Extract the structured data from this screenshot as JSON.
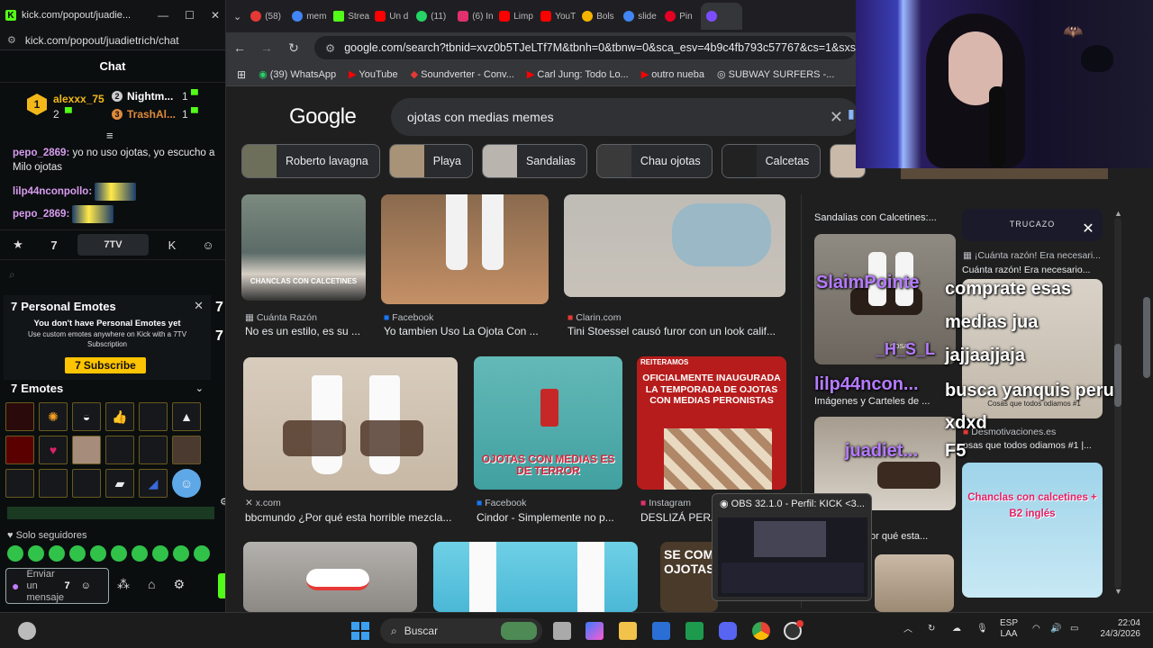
{
  "kick": {
    "window_title": "kick.com/popout/juadie...",
    "url": "kick.com/popout/juadietrich/chat",
    "chat_title": "Chat",
    "leaderboard": [
      {
        "rank": "1",
        "name": "alexxx_75",
        "count": "2"
      },
      {
        "rank": "2",
        "name": "Nightm...",
        "count": "1"
      },
      {
        "rank": "3",
        "name": "TrashAl...",
        "count": "1"
      }
    ],
    "messages": [
      {
        "user": "pepo_2869:",
        "text": " yo no uso ojotas, yo escucho a Milo ojotas",
        "color": "#d89cf0"
      },
      {
        "user": "lilp44nconpollo:",
        "text": "",
        "color": "#d89cf0"
      },
      {
        "user": "pepo_2869:",
        "text": "",
        "color": "#d89cf0"
      }
    ],
    "tab_active": "7TV",
    "personal_emotes": {
      "title": "Personal Emotes",
      "line1": "You don't have Personal Emotes yet",
      "line2": "Use custom emotes anywhere on Kick with a 7TV Subscription",
      "subscribe": "Subscribe"
    },
    "emotes_title": "Emotes",
    "solo_seguidores": "Solo seguidores",
    "input_placeholder": "Enviar un mensaje",
    "accent": "#53fc18"
  },
  "browser": {
    "tabs": [
      {
        "label": "(58)",
        "color": "#e53935"
      },
      {
        "label": "mem",
        "color": "#4285f4"
      },
      {
        "label": "Strea",
        "color": "#53fc18"
      },
      {
        "label": "Un d",
        "color": "#ff0000"
      },
      {
        "label": "(11)",
        "color": "#25d366"
      },
      {
        "label": "(6) In",
        "color": "#e1306c"
      },
      {
        "label": "Limp",
        "color": "#ff0000"
      },
      {
        "label": "YouT",
        "color": "#ff0000"
      },
      {
        "label": "Bols",
        "color": "#f4b400"
      },
      {
        "label": "slide",
        "color": "#4285f4"
      },
      {
        "label": "Pin",
        "color": "#e60023"
      },
      {
        "label": "",
        "color": "#7c4dff"
      }
    ],
    "url": "google.com/search?tbnid=xvz0b5TJeLTf7M&tbnh=0&tbnw=0&sca_esv=4b9c4fb793c57767&cs=1&sxsrf=ANb",
    "bookmarks": [
      {
        "label": "(39) WhatsApp"
      },
      {
        "label": "YouTube"
      },
      {
        "label": "Soundverter - Conv..."
      },
      {
        "label": "Carl Jung: Todo Lo..."
      },
      {
        "label": "outro nueba"
      },
      {
        "label": "SUBWAY SURFERS -..."
      }
    ]
  },
  "google": {
    "logo": "Google",
    "query": "ojotas con medias memes",
    "chips": [
      "Roberto lavagna",
      "Playa",
      "Sandalias",
      "Chau ojotas",
      "Calcetas"
    ],
    "results": [
      {
        "source": "Cuánta Razón",
        "caption": "No es un estilo, es su ...",
        "thumb_text": "CHANCLAS CON CALCETINES"
      },
      {
        "source": "Facebook",
        "caption": "Yo tambien Uso La Ojota Con ..."
      },
      {
        "source": "Clarin.com",
        "caption": "Tini Stoessel causó furor con un look calif..."
      },
      {
        "source": "x.com",
        "caption": "bbcmundo ¿Por qué esta horrible mezcla..."
      },
      {
        "source": "Facebook",
        "caption": "Cindor - Simplemente no p...",
        "thumb_text": "OJOTAS CON MEDIAS ES DE TERROR"
      },
      {
        "source": "Instagram",
        "caption": "DESLIZÁ PERA...",
        "thumb_text": "OFICIALMENTE INAUGURADA LA TEMPORADA DE OJOTAS CON MEDIAS PERONISTAS",
        "tag": "REITERAMOS"
      }
    ],
    "bottom_thumb_text": "SE COM OJOTAS",
    "side": {
      "title": "Sandalias con Calcetines:...",
      "trucazo": "TRUCAZO",
      "src1": "¡Cuánta razón! Era necesari...",
      "cap1": "Cuánta razón! Era necesario...",
      "mid_src": "Imágenes y Carteles de ...",
      "src2": "Desmotivaciones.es",
      "cap2": "osas que todos odiamos #1 |...",
      "cap3": "or qué esta...",
      "chanclas": "Chanclas con calcetines + B2 inglés",
      "cosas": "Cosas que todos odiamos #1",
      "cosas_small": "COSAS"
    }
  },
  "overlay": {
    "chat_lines": [
      {
        "user": "SlaimPointe",
        "text": "comprate esas medias jua jajjaajjaja"
      },
      {
        "user": "lilp44ncon...",
        "text": "busca yanquis peru xdxd"
      },
      {
        "user": "juadiet...",
        "text": "F5"
      }
    ],
    "hsl": "_H_S_L"
  },
  "obs": {
    "title": "OBS 32.1.0 - Perfil: KICK <3..."
  },
  "taskbar": {
    "search": "Buscar",
    "lang": "ESP",
    "lang2": "LAA",
    "time": "22:04",
    "date": "24/3/2026"
  }
}
